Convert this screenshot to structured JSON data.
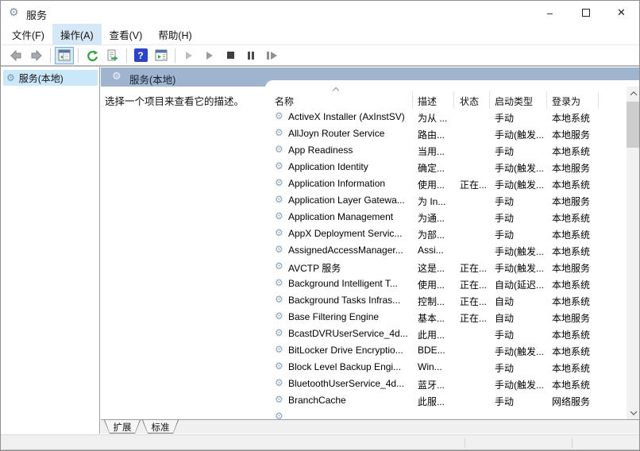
{
  "icons": {
    "gear": "⚙",
    "help_glyph": "?"
  },
  "window": {
    "title": "服务",
    "controls": {
      "minimize": "–",
      "maximize": "",
      "close": "✕"
    }
  },
  "menu": {
    "items": [
      {
        "label": "文件(F)"
      },
      {
        "label": "操作(A)",
        "active": true
      },
      {
        "label": "查看(V)"
      },
      {
        "label": "帮助(H)"
      }
    ]
  },
  "toolbar": {
    "icons": [
      "back-icon",
      "forward-icon",
      "show-console-tree-icon",
      "refresh-icon",
      "export-list-icon",
      "help-icon",
      "show-window-icon",
      "start-service-icon",
      "resume-service-icon",
      "stop-service-icon",
      "pause-service-icon",
      "restart-service-icon"
    ]
  },
  "tree": {
    "items": [
      {
        "label": "服务(本地)",
        "selected": true
      }
    ]
  },
  "content_header": {
    "title": "服务(本地)"
  },
  "description_pane": {
    "hint": "选择一个项目来查看它的描述。"
  },
  "services_table": {
    "columns": [
      "名称",
      "描述",
      "状态",
      "启动类型",
      "登录为"
    ],
    "partial_row_visible": true,
    "rows": [
      {
        "name": "ActiveX Installer (AxInstSV)",
        "description": "为从 ...",
        "status": "",
        "startup_type": "手动",
        "logon_as": "本地系统"
      },
      {
        "name": "AllJoyn Router Service",
        "description": "路由...",
        "status": "",
        "startup_type": "手动(触发...",
        "logon_as": "本地服务"
      },
      {
        "name": "App Readiness",
        "description": "当用...",
        "status": "",
        "startup_type": "手动",
        "logon_as": "本地系统"
      },
      {
        "name": "Application Identity",
        "description": "确定...",
        "status": "",
        "startup_type": "手动(触发...",
        "logon_as": "本地服务"
      },
      {
        "name": "Application Information",
        "description": "使用...",
        "status": "正在...",
        "startup_type": "手动(触发...",
        "logon_as": "本地系统"
      },
      {
        "name": "Application Layer Gatewa...",
        "description": "为 In...",
        "status": "",
        "startup_type": "手动",
        "logon_as": "本地服务"
      },
      {
        "name": "Application Management",
        "description": "为通...",
        "status": "",
        "startup_type": "手动",
        "logon_as": "本地系统"
      },
      {
        "name": "AppX Deployment Servic...",
        "description": "为部...",
        "status": "",
        "startup_type": "手动",
        "logon_as": "本地系统"
      },
      {
        "name": "AssignedAccessManager...",
        "description": "Assi...",
        "status": "",
        "startup_type": "手动(触发...",
        "logon_as": "本地系统"
      },
      {
        "name": "AVCTP 服务",
        "description": "这是...",
        "status": "正在...",
        "startup_type": "手动(触发...",
        "logon_as": "本地服务"
      },
      {
        "name": "Background Intelligent T...",
        "description": "使用...",
        "status": "正在...",
        "startup_type": "自动(延迟...",
        "logon_as": "本地系统"
      },
      {
        "name": "Background Tasks Infras...",
        "description": "控制...",
        "status": "正在...",
        "startup_type": "自动",
        "logon_as": "本地系统"
      },
      {
        "name": "Base Filtering Engine",
        "description": "基本...",
        "status": "正在...",
        "startup_type": "自动",
        "logon_as": "本地服务"
      },
      {
        "name": "BcastDVRUserService_4d...",
        "description": "此用...",
        "status": "",
        "startup_type": "手动",
        "logon_as": "本地系统"
      },
      {
        "name": "BitLocker Drive Encryptio...",
        "description": "BDE...",
        "status": "",
        "startup_type": "手动(触发...",
        "logon_as": "本地系统"
      },
      {
        "name": "Block Level Backup Engi...",
        "description": "Win...",
        "status": "",
        "startup_type": "手动",
        "logon_as": "本地系统"
      },
      {
        "name": "BluetoothUserService_4d...",
        "description": "蓝牙...",
        "status": "",
        "startup_type": "手动(触发...",
        "logon_as": "本地系统"
      },
      {
        "name": "BranchCache",
        "description": "此服...",
        "status": "",
        "startup_type": "手动",
        "logon_as": "网络服务"
      }
    ]
  },
  "bottom_tabs": {
    "tabs": [
      "扩展",
      "标准"
    ],
    "active": "扩展"
  },
  "colors": {
    "header_bar": "#9FB5CF",
    "tree_selection": "#CBE7FA",
    "menu_highlight": "#D6E7F6",
    "help_blue": "#2B43C4",
    "icon_green": "#3BA55D",
    "scroll_track": "#F1F1F1",
    "scroll_thumb": "#CDCDCD",
    "statusbar": "#F0F0F0"
  }
}
